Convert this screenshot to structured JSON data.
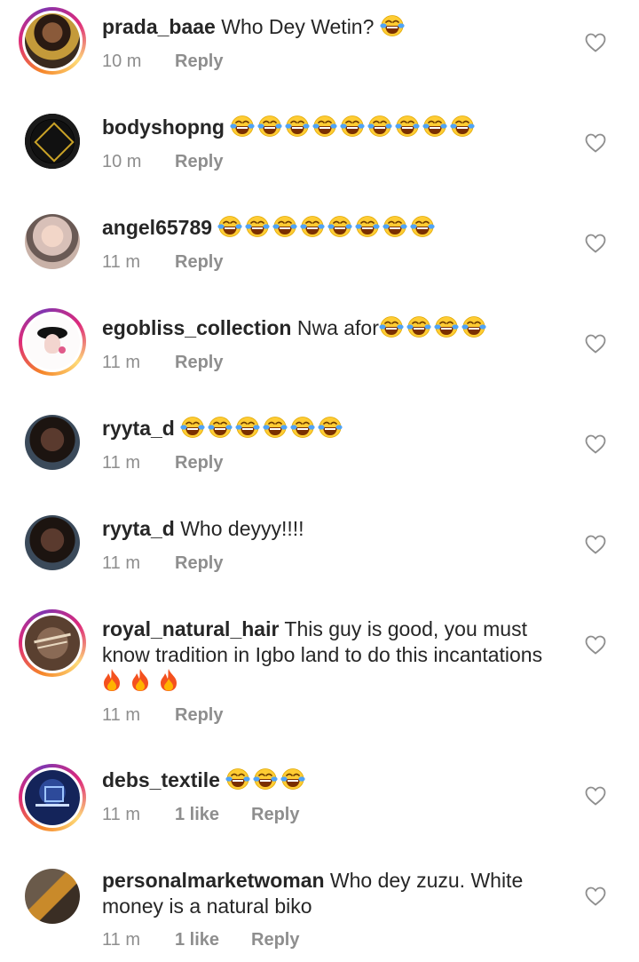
{
  "comments": [
    {
      "username": "prada_baae",
      "text": "Who Dey Wetin?",
      "emoji_count": 1,
      "time": "10 m",
      "likes": "",
      "reply": "Reply",
      "story_ring": true
    },
    {
      "username": "bodyshopng",
      "text": "",
      "emoji_count": 9,
      "time": "10 m",
      "likes": "",
      "reply": "Reply",
      "story_ring": false
    },
    {
      "username": "angel65789",
      "text": "",
      "emoji_count": 8,
      "time": "11 m",
      "likes": "",
      "reply": "Reply",
      "story_ring": false
    },
    {
      "username": "egobliss_collection",
      "text": "Nwa afor",
      "emoji_count": 4,
      "time": "11 m",
      "likes": "",
      "reply": "Reply",
      "story_ring": true
    },
    {
      "username": "ryyta_d",
      "text": "",
      "emoji_count": 6,
      "time": "11 m",
      "likes": "",
      "reply": "Reply",
      "story_ring": false
    },
    {
      "username": "ryyta_d",
      "text": "Who deyyy!!!!",
      "emoji_count": 0,
      "time": "11 m",
      "likes": "",
      "reply": "Reply",
      "story_ring": false
    },
    {
      "username": "royal_natural_hair",
      "text": "This guy is good, you must know tradition in Igbo land to do this incantations",
      "fire_count": 3,
      "time": "11 m",
      "likes": "",
      "reply": "Reply",
      "story_ring": true
    },
    {
      "username": "debs_textile",
      "text": "",
      "emoji_count": 3,
      "time": "11 m",
      "likes": "1 like",
      "reply": "Reply",
      "story_ring": true
    },
    {
      "username": "personalmarketwoman",
      "text": "Who dey zuzu. White money is a natural biko",
      "emoji_count": 0,
      "time": "11 m",
      "likes": "1 like",
      "reply": "Reply",
      "story_ring": false
    }
  ],
  "icons": {
    "emoji": "face-with-tears-of-joy-icon",
    "fire": "fire-icon",
    "like": "heart-outline-icon"
  },
  "colors": {
    "text": "#262626",
    "meta": "#8e8e8e",
    "emoji_face": "#ffcc33",
    "tears": "#4fa3f7"
  }
}
